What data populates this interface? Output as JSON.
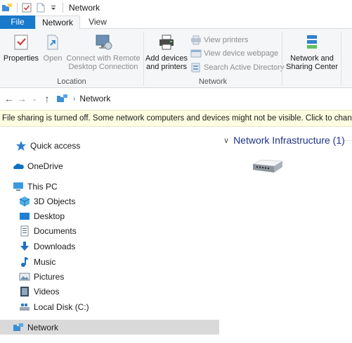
{
  "titlebar": {
    "title": "Network"
  },
  "tabs": {
    "file": "File",
    "network": "Network",
    "view": "View"
  },
  "ribbon": {
    "location": {
      "label": "Location",
      "properties": "Properties",
      "open": "Open",
      "connect_line1": "Connect with Remote",
      "connect_line2": "Desktop Connection"
    },
    "network": {
      "label": "Network",
      "add_devices_line1": "Add devices",
      "add_devices_line2": "and printers",
      "view_printers": "View printers",
      "view_device_webpage": "View device webpage",
      "search_active_directory": "Search Active Directory",
      "sharing_line1": "Network and",
      "sharing_line2": "Sharing Center"
    }
  },
  "address": {
    "crumb": "Network"
  },
  "infobar": {
    "text": "File sharing is turned off. Some network computers and devices might not be visible. Click to change..."
  },
  "navpane": {
    "quick_access": "Quick access",
    "onedrive": "OneDrive",
    "this_pc": "This PC",
    "objects3d": "3D Objects",
    "desktop": "Desktop",
    "documents": "Documents",
    "downloads": "Downloads",
    "music": "Music",
    "pictures": "Pictures",
    "videos": "Videos",
    "local_disk": "Local Disk (C:)",
    "network": "Network"
  },
  "content": {
    "group_title": "Network Infrastructure (1)"
  },
  "colors": {
    "accent": "#1979ca",
    "selected": "#d9d9d9",
    "infobar": "#fffde2",
    "group_title": "#1e3287"
  }
}
